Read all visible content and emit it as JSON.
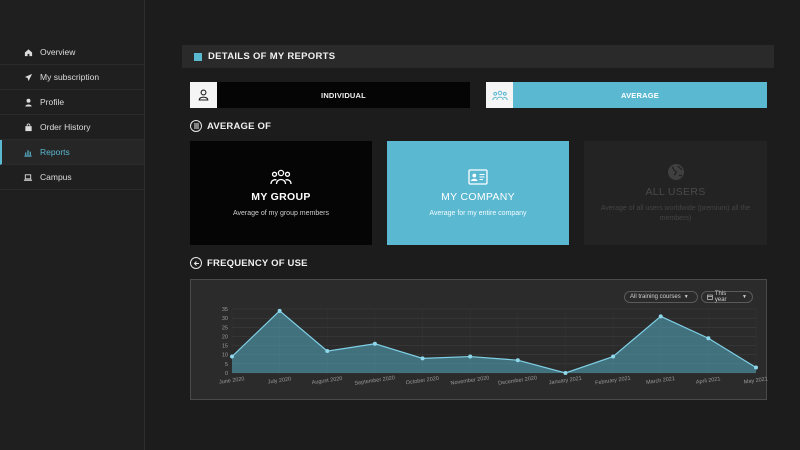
{
  "sidebar": {
    "items": [
      {
        "label": "Overview",
        "icon": "home-icon"
      },
      {
        "label": "My subscription",
        "icon": "paper-plane-icon"
      },
      {
        "label": "Profile",
        "icon": "user-icon"
      },
      {
        "label": "Order History",
        "icon": "shopping-bag-icon"
      },
      {
        "label": "Reports",
        "icon": "bar-chart-icon",
        "active": true
      },
      {
        "label": "Campus",
        "icon": "laptop-icon"
      }
    ]
  },
  "header": {
    "title": "DETAILS OF MY REPORTS"
  },
  "toggles": {
    "individual": "INDIVIDUAL",
    "average": "AVERAGE"
  },
  "average_of": {
    "title": "AVERAGE OF",
    "cards": [
      {
        "title": "MY GROUP",
        "desc": "Average of my group members"
      },
      {
        "title": "MY COMPANY",
        "desc": "Average for my entire company"
      },
      {
        "title": "ALL USERS",
        "desc": "Average of all users worldwide (premium) all the members)"
      }
    ]
  },
  "frequency": {
    "title": "FREQUENCY OF USE",
    "filter_courses": "All training courses",
    "filter_year": "This year"
  },
  "colors": {
    "accent": "#5ab8d1",
    "dark": "#050505",
    "bg": "#1c1c1c"
  },
  "chart_data": {
    "type": "area",
    "categories": [
      "June 2020",
      "July 2020",
      "August 2020",
      "September 2020",
      "October 2020",
      "November 2020",
      "December 2020",
      "January 2021",
      "February 2021",
      "March 2021",
      "April 2021",
      "May 2021"
    ],
    "values": [
      9,
      34,
      12,
      16,
      8,
      9,
      7,
      0,
      9,
      31,
      19,
      3
    ],
    "yticks": [
      0,
      5,
      10,
      15,
      20,
      25,
      30,
      35
    ],
    "ylim": [
      0,
      35
    ],
    "grid": true,
    "legend": "none"
  }
}
